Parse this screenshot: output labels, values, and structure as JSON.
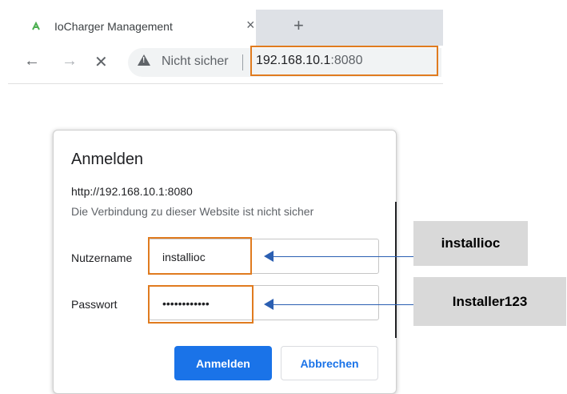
{
  "browser": {
    "tab_title": "IoCharger Management",
    "tab_close": "×",
    "new_tab": "+",
    "back": "←",
    "forward": "→",
    "stop": "✕",
    "security_label": "Nicht sicher",
    "url_host": "192.168.10.1",
    "url_port": ":8080"
  },
  "dialog": {
    "title": "Anmelden",
    "url": "http://192.168.10.1:8080",
    "message": "Die Verbindung zu dieser Website ist nicht sicher",
    "username_label": "Nutzername",
    "username_value": "installioc",
    "password_label": "Passwort",
    "password_value": "••••••••••••",
    "submit_label": "Anmelden",
    "cancel_label": "Abbrechen"
  },
  "annotations": {
    "username_note": "installioc",
    "password_note": "Installer123"
  },
  "colors": {
    "highlight": "#e07b1f",
    "primary_button": "#1a73e8",
    "arrow": "#2b5fb2",
    "note_bg": "#d9d9d9"
  }
}
